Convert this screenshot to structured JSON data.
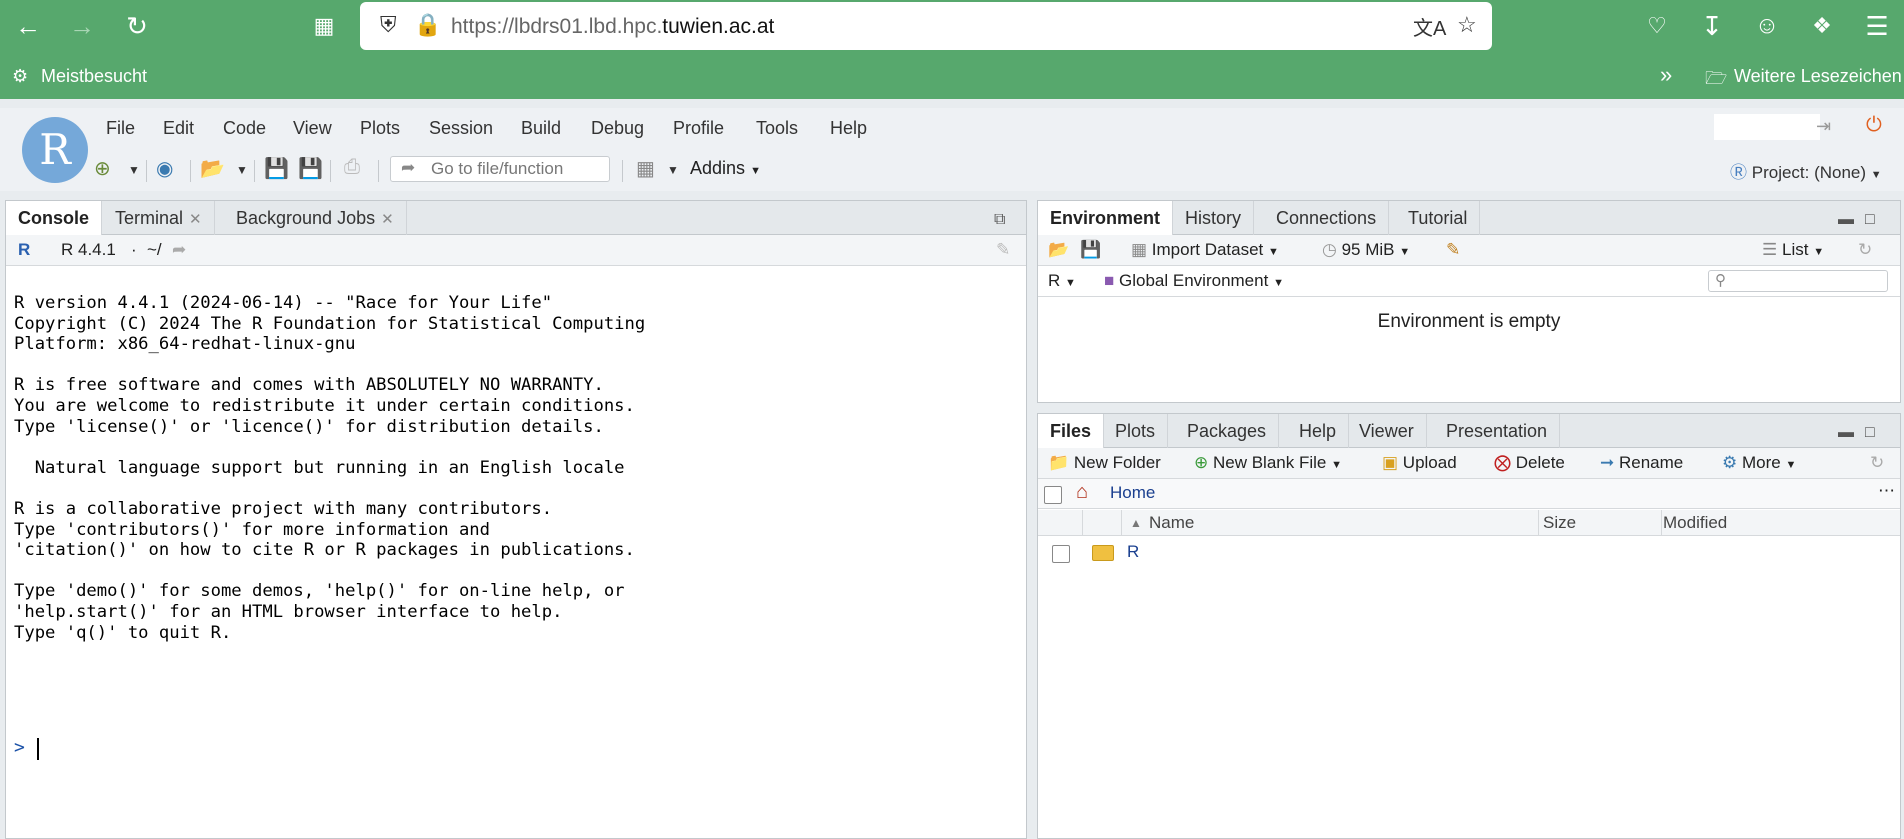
{
  "browser": {
    "url_prefix": "https://lbdrs01.lbd.hpc.",
    "url_domain": "tuwien.ac.at",
    "bookmark_left": "Meistbesucht",
    "bookmark_right": "Weitere Lesezeichen"
  },
  "menu": [
    "File",
    "Edit",
    "Code",
    "View",
    "Plots",
    "Session",
    "Build",
    "Debug",
    "Profile",
    "Tools",
    "Help"
  ],
  "toolbar": {
    "goto_placeholder": "Go to file/function",
    "addins_label": "Addins",
    "project_label": "Project: (None)"
  },
  "console_pane": {
    "tabs": [
      "Console",
      "Terminal",
      "Background Jobs"
    ],
    "r_version": "R 4.4.1",
    "working_dir": "~/",
    "lines": [
      "R version 4.4.1 (2024-06-14) -- \"Race for Your Life\"",
      "Copyright (C) 2024 The R Foundation for Statistical Computing",
      "Platform: x86_64-redhat-linux-gnu",
      "",
      "R is free software and comes with ABSOLUTELY NO WARRANTY.",
      "You are welcome to redistribute it under certain conditions.",
      "Type 'license()' or 'licence()' for distribution details.",
      "",
      "  Natural language support but running in an English locale",
      "",
      "R is a collaborative project with many contributors.",
      "Type 'contributors()' for more information and",
      "'citation()' on how to cite R or R packages in publications.",
      "",
      "Type 'demo()' for some demos, 'help()' for on-line help, or",
      "'help.start()' for an HTML browser interface to help.",
      "Type 'q()' to quit R."
    ],
    "prompt": ">"
  },
  "env_pane": {
    "tabs": [
      "Environment",
      "History",
      "Connections",
      "Tutorial"
    ],
    "import_label": "Import Dataset",
    "memory": "95 MiB",
    "list_label": "List",
    "lang": "R",
    "scope": "Global Environment",
    "empty_message": "Environment is empty"
  },
  "files_pane": {
    "tabs": [
      "Files",
      "Plots",
      "Packages",
      "Help",
      "Viewer",
      "Presentation"
    ],
    "actions": [
      "New Folder",
      "New Blank File",
      "Upload",
      "Delete",
      "Rename",
      "More"
    ],
    "breadcrumb": "Home",
    "columns": [
      "Name",
      "Size",
      "Modified"
    ],
    "files": [
      {
        "name": "R"
      }
    ]
  }
}
